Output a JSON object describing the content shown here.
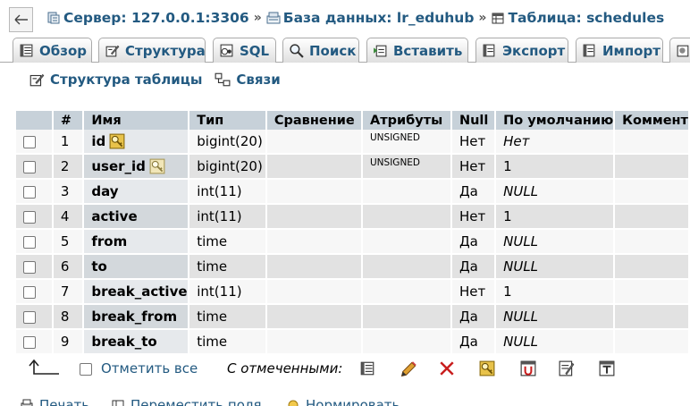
{
  "breadcrumb": {
    "server": "Сервер: 127.0.0.1:3306",
    "database": "База данных: lr_eduhub",
    "table": "Таблица: schedules",
    "separator": "»"
  },
  "tabs": [
    "Обзор",
    "Структура",
    "SQL",
    "Поиск",
    "Вставить",
    "Экспорт",
    "Импорт"
  ],
  "sublinks": {
    "structure": "Структура таблицы",
    "relations": "Связи"
  },
  "table": {
    "headers": [
      "#",
      "Имя",
      "Тип",
      "Сравнение",
      "Атрибуты",
      "Null",
      "По умолчанию",
      "Коммент"
    ],
    "rows": [
      {
        "num": "1",
        "name": "id",
        "type": "bigint(20)",
        "collation": "",
        "attributes": "UNSIGNED",
        "null": "Нет",
        "default": "Нет"
      },
      {
        "num": "2",
        "name": "user_id",
        "type": "bigint(20)",
        "collation": "",
        "attributes": "UNSIGNED",
        "null": "Нет",
        "default": "1"
      },
      {
        "num": "3",
        "name": "day",
        "type": "int(11)",
        "collation": "",
        "attributes": "",
        "null": "Да",
        "default": "NULL"
      },
      {
        "num": "4",
        "name": "active",
        "type": "int(11)",
        "collation": "",
        "attributes": "",
        "null": "Нет",
        "default": "1"
      },
      {
        "num": "5",
        "name": "from",
        "type": "time",
        "collation": "",
        "attributes": "",
        "null": "Да",
        "default": "NULL"
      },
      {
        "num": "6",
        "name": "to",
        "type": "time",
        "collation": "",
        "attributes": "",
        "null": "Да",
        "default": "NULL"
      },
      {
        "num": "7",
        "name": "break_active",
        "type": "int(11)",
        "collation": "",
        "attributes": "",
        "null": "Нет",
        "default": "1"
      },
      {
        "num": "8",
        "name": "break_from",
        "type": "time",
        "collation": "",
        "attributes": "",
        "null": "Да",
        "default": "NULL"
      },
      {
        "num": "9",
        "name": "break_to",
        "type": "time",
        "collation": "",
        "attributes": "",
        "null": "Да",
        "default": "NULL"
      }
    ]
  },
  "footer": {
    "check_all": "Отметить все",
    "with_selected": "С отмеченными:"
  },
  "bottom_links": [
    "Печать",
    "Переместить поля",
    "Нормировать"
  ],
  "colors": {
    "link": "#235a81",
    "header_bg": "#c7d1d9",
    "row_odd": "#f7f7f7",
    "row_even": "#e2e2e2"
  }
}
